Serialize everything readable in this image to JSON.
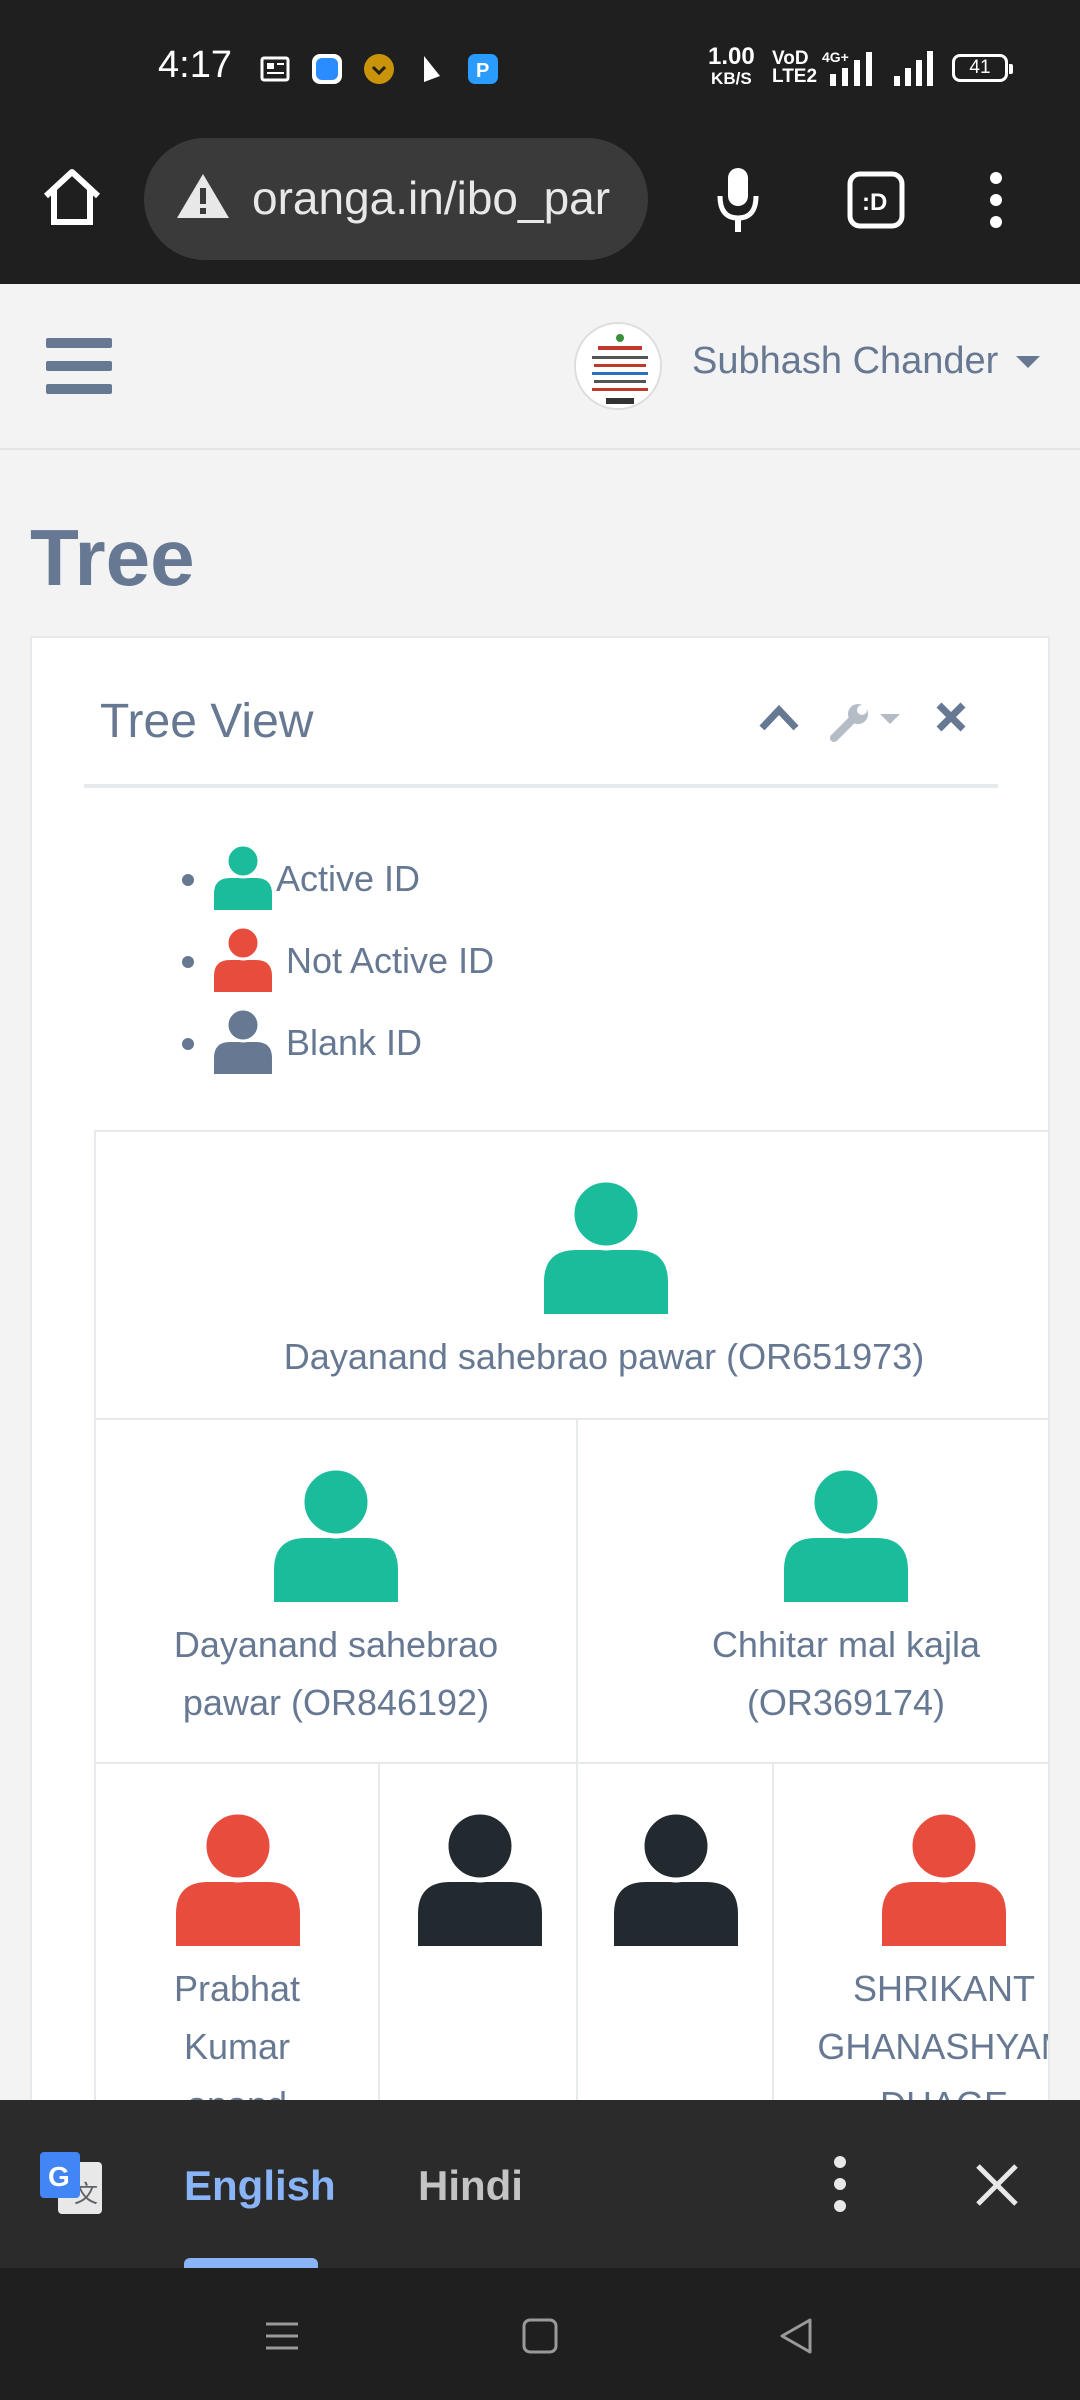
{
  "status_bar": {
    "time": "4:17",
    "net_speed": "1.00",
    "net_speed_unit": "KB/S",
    "volte": "VoD LTE2",
    "network": "4G+",
    "battery": "41"
  },
  "browser": {
    "url": "oranga.in/ibo_par",
    "icons": [
      "home-icon",
      "warning-icon",
      "mic-icon",
      "tab-switcher-icon",
      "more-vert-icon"
    ]
  },
  "header": {
    "user_name": "Subhash Chander"
  },
  "page": {
    "title": "Tree"
  },
  "panel": {
    "title": "Tree View",
    "legend": [
      {
        "label": "Active ID",
        "color": "#1abc9c"
      },
      {
        "label": "Not Active ID",
        "color": "#e74c3c"
      },
      {
        "label": "Blank ID",
        "color": "#667892"
      }
    ]
  },
  "tree": {
    "root": {
      "name": "Dayanand sahebrao pawar (OR651973)",
      "status": "active"
    },
    "level2": [
      {
        "name_line1": "Dayanand sahebrao",
        "name_line2": "pawar (OR846192)",
        "status": "active"
      },
      {
        "name_line1": "Chhitar mal kajla",
        "name_line2": "(OR369174)",
        "status": "active"
      }
    ],
    "level3": [
      {
        "line1": "Prabhat",
        "line2": "Kumar",
        "line3": "anand",
        "status": "inactive"
      },
      {
        "line1": "",
        "status": "blank"
      },
      {
        "line1": "",
        "status": "blank"
      },
      {
        "line1": "SHRIKANT",
        "line2": "GHANASHYAM",
        "line3": "DHAGE",
        "status": "inactive"
      }
    ]
  },
  "colors": {
    "active": "#1abc9c",
    "inactive": "#e74c3c",
    "blank_legend": "#667892",
    "blank_node": "#222a30",
    "text": "#667892"
  },
  "translate_bar": {
    "lang_selected": "English",
    "lang_other": "Hindi"
  }
}
